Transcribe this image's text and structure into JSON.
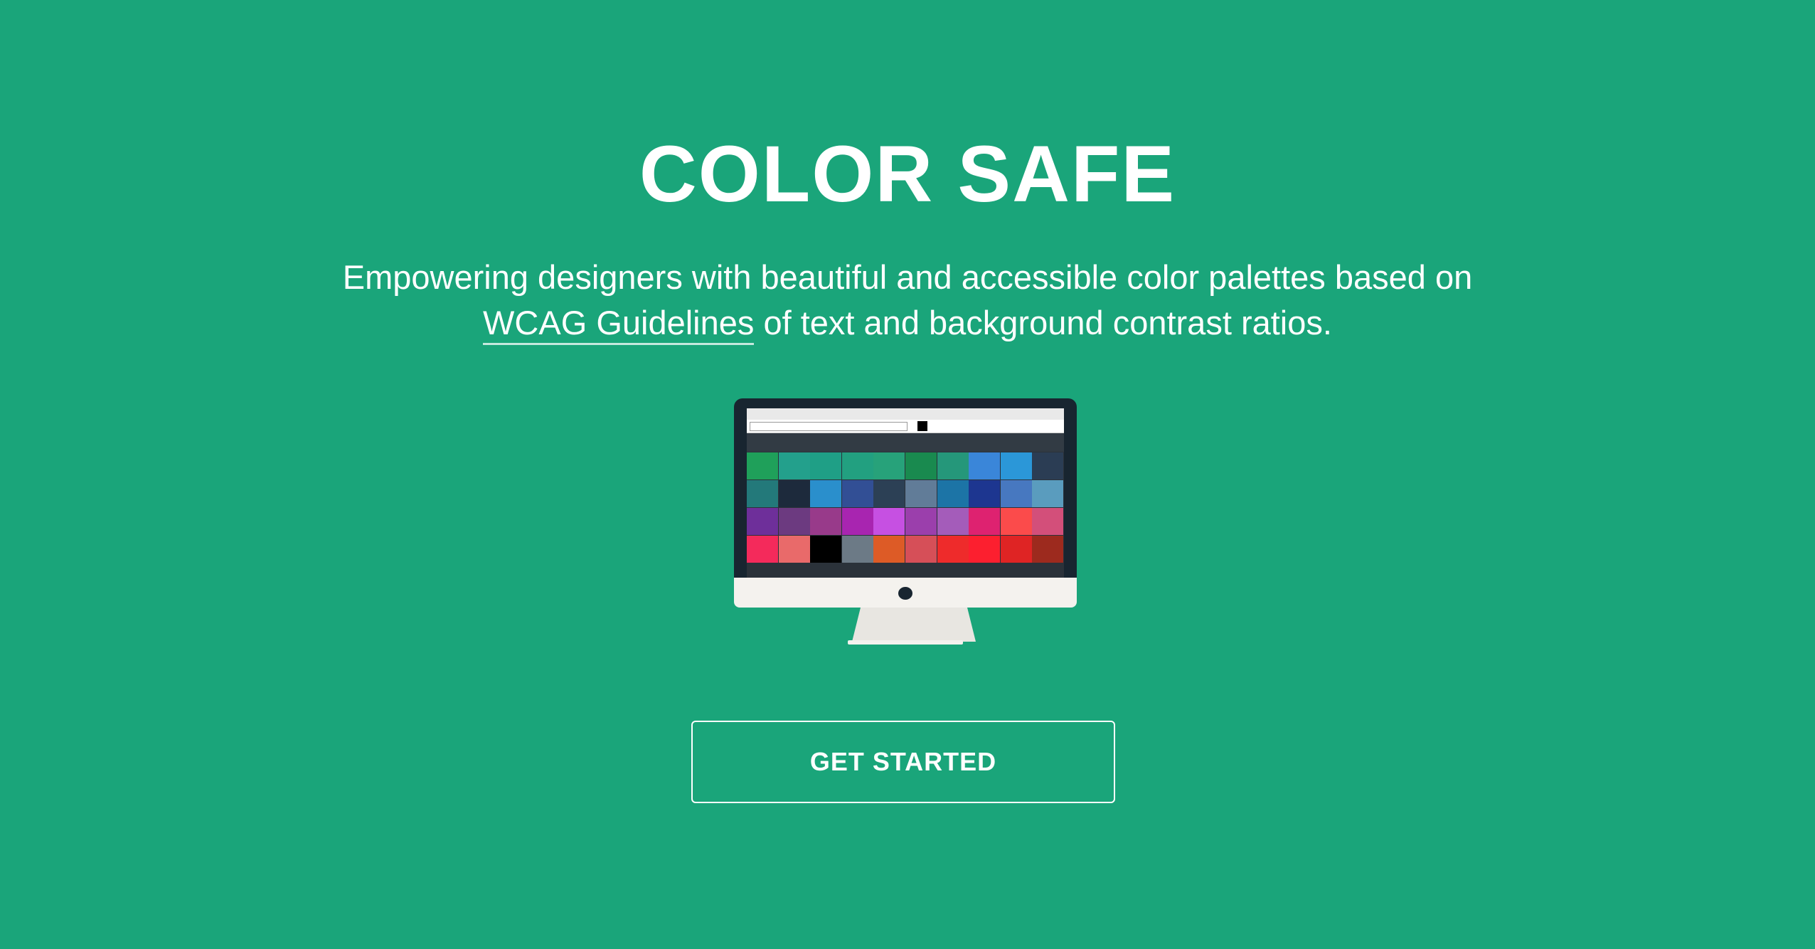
{
  "hero": {
    "title": "COLOR SAFE",
    "tagline_prefix": "Empowering designers with beautiful and accessible color palettes based on",
    "tagline_link": "WCAG Guidelines",
    "tagline_suffix": "of text and background contrast ratios."
  },
  "cta": {
    "label": "GET STARTED"
  },
  "colors": {
    "background": "#1aa57a",
    "text": "#ffffff",
    "monitor_bezel": "#182530",
    "monitor_chin": "#f4f2ee"
  },
  "illustration": {
    "palette_rows": [
      [
        "#1fa05a",
        "#23a08c",
        "#1f9f86",
        "#22a080",
        "#27a27a",
        "#198a4f",
        "#25977a",
        "#3a86d9",
        "#2b97d8",
        "#2b3d54"
      ],
      [
        "#23797a",
        "#1d2a3c",
        "#2a8fcc",
        "#324f95",
        "#2c4055",
        "#617c98",
        "#1c74a6",
        "#1d3690",
        "#4778c0",
        "#5a9cbe"
      ],
      [
        "#6e2f9a",
        "#6c3a80",
        "#983a8a",
        "#a825b0",
        "#c650e2",
        "#9b3fac",
        "#a45cba",
        "#de2270",
        "#fb4b4b",
        "#d34f7a"
      ],
      [
        "#f42a5b",
        "#e96a6a",
        "#000000",
        "#6c7a86",
        "#dd5b26",
        "#d64f58",
        "#ee2b2b",
        "#fc1f2f",
        "#df2424",
        "#9d2a1e"
      ]
    ]
  }
}
